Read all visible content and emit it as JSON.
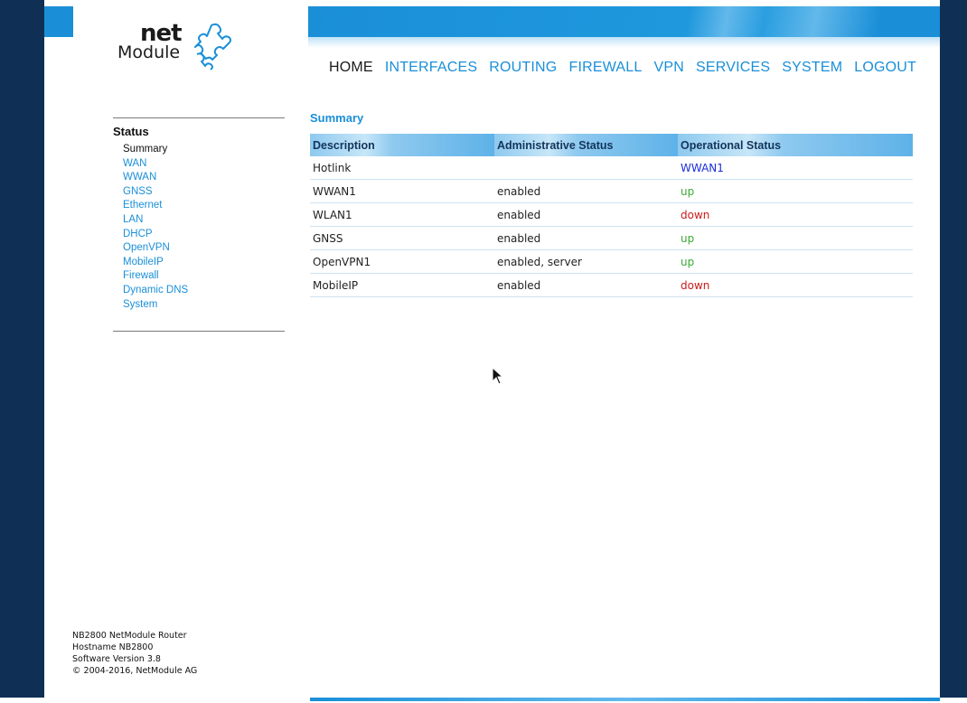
{
  "logo": {
    "brand_bold": "net",
    "brand_regular": "Module"
  },
  "nav": {
    "items": [
      {
        "label": "HOME",
        "active": true
      },
      {
        "label": "INTERFACES",
        "active": false
      },
      {
        "label": "ROUTING",
        "active": false
      },
      {
        "label": "FIREWALL",
        "active": false
      },
      {
        "label": "VPN",
        "active": false
      },
      {
        "label": "SERVICES",
        "active": false
      },
      {
        "label": "SYSTEM",
        "active": false
      },
      {
        "label": "LOGOUT",
        "active": false
      }
    ]
  },
  "sidebar": {
    "title": "Status",
    "items": [
      {
        "label": "Summary",
        "current": true
      },
      {
        "label": "WAN"
      },
      {
        "label": "WWAN"
      },
      {
        "label": "GNSS"
      },
      {
        "label": "Ethernet"
      },
      {
        "label": "LAN"
      },
      {
        "label": "DHCP"
      },
      {
        "label": "OpenVPN"
      },
      {
        "label": "MobileIP"
      },
      {
        "label": "Firewall"
      },
      {
        "label": "Dynamic DNS"
      },
      {
        "label": "System"
      }
    ]
  },
  "system_info": {
    "lines": [
      "NB2800 NetModule Router",
      "Hostname NB2800",
      "Software Version 3.8",
      "© 2004-2016, NetModule AG"
    ]
  },
  "main": {
    "title": "Summary",
    "columns": [
      "Description",
      "Administrative Status",
      "Operational Status"
    ],
    "rows": [
      {
        "description": "Hotlink",
        "admin": "",
        "operational": "WWAN1",
        "state": "link"
      },
      {
        "description": "WWAN1",
        "admin": "enabled",
        "operational": "up",
        "state": "up"
      },
      {
        "description": "WLAN1",
        "admin": "enabled",
        "operational": "down",
        "state": "down"
      },
      {
        "description": "GNSS",
        "admin": "enabled",
        "operational": "up",
        "state": "up"
      },
      {
        "description": "OpenVPN1",
        "admin": "enabled, server",
        "operational": "up",
        "state": "up"
      },
      {
        "description": "MobileIP",
        "admin": "enabled",
        "operational": "down",
        "state": "down"
      }
    ]
  },
  "colors": {
    "accent": "#1a8fd8",
    "frame": "#0f2f55",
    "status_up": "#3aaa35",
    "status_down": "#cc1a1a",
    "status_link": "#1a2fd8"
  },
  "icons": {
    "logo_mark": "puzzle-pieces-icon",
    "pointer": "mouse-cursor-icon"
  }
}
